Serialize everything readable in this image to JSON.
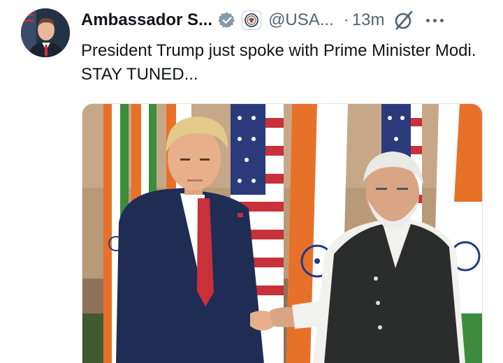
{
  "tweet": {
    "author": {
      "name": "Ambassador S...",
      "handle": "@USA...",
      "avatar_icon": "person-portrait-avatar",
      "verified_icon": "verified-badge-icon",
      "affiliate_icon": "us-seal-affiliate-icon"
    },
    "separator": "·",
    "time": "13m",
    "grok_icon": "grok-icon",
    "more_icon": "more-options-icon",
    "text": "President Trump just spoke with Prime Minister Modi. STAY TUNED...",
    "media": {
      "kind": "photo",
      "icon": "photo-handshake-flags"
    },
    "colors": {
      "verified_badge": "#829aab",
      "text": "#0f1419",
      "secondary": "#536471",
      "saffron": "#e8712a",
      "india_green": "#3d8b3d",
      "us_blue": "#2a3a7a",
      "us_red": "#c8303a"
    }
  }
}
